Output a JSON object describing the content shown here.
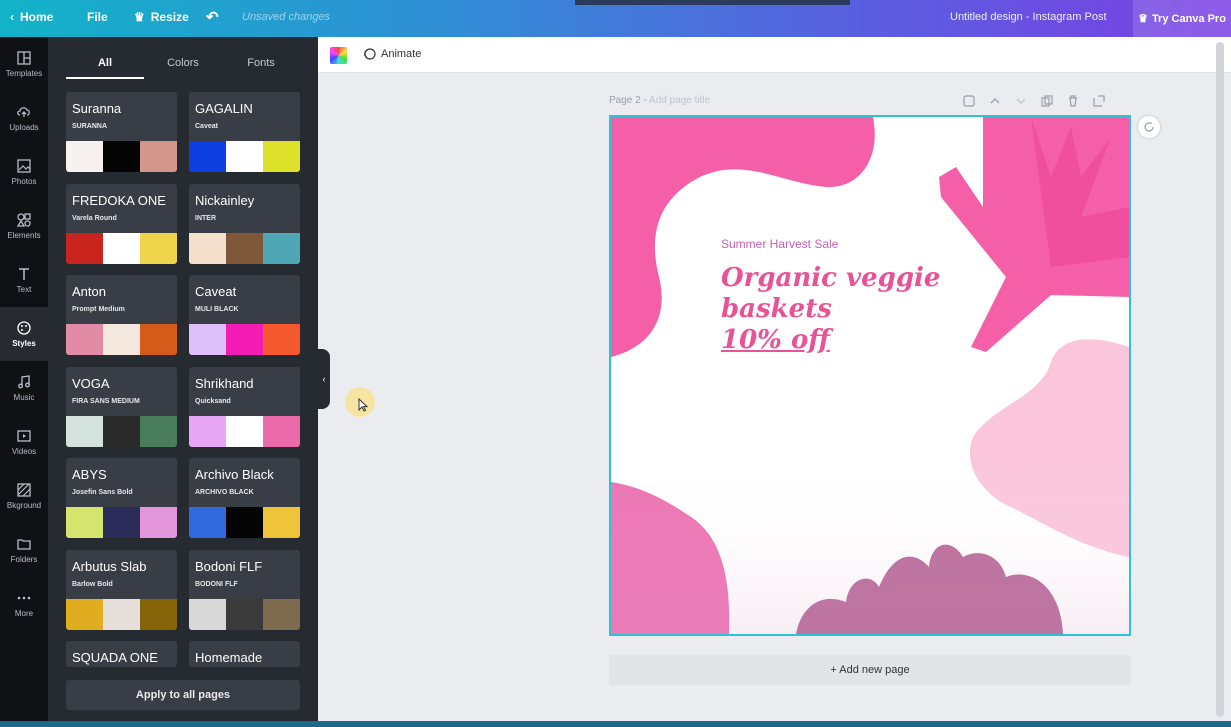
{
  "topbar": {
    "home": "Home",
    "file": "File",
    "resize": "Resize",
    "unsaved": "Unsaved changes",
    "design_title": "Untitled design - Instagram Post",
    "try_pro": "Try Canva Pro"
  },
  "rail": [
    {
      "label": "Templates",
      "icon": "templates-icon"
    },
    {
      "label": "Uploads",
      "icon": "upload-icon"
    },
    {
      "label": "Photos",
      "icon": "photos-icon"
    },
    {
      "label": "Elements",
      "icon": "elements-icon"
    },
    {
      "label": "Text",
      "icon": "text-icon"
    },
    {
      "label": "Styles",
      "icon": "palette-icon",
      "active": true
    },
    {
      "label": "Music",
      "icon": "music-icon"
    },
    {
      "label": "Videos",
      "icon": "videos-icon"
    },
    {
      "label": "Bkground",
      "icon": "background-icon"
    },
    {
      "label": "Folders",
      "icon": "folder-icon"
    },
    {
      "label": "More",
      "icon": "more-icon"
    }
  ],
  "panel": {
    "tabs": [
      "All",
      "Colors",
      "Fonts"
    ],
    "active_tab": "All",
    "cards": [
      {
        "heading": "Suranna",
        "sub": "SURANNA",
        "colors": [
          "#f7f1f0",
          "#050505",
          "#d4958a"
        ]
      },
      {
        "heading": "GAGALIN",
        "sub": "Caveat",
        "colors": [
          "#0d3fe0",
          "#ffffff",
          "#dde12a"
        ]
      },
      {
        "heading": "FREDOKA ONE",
        "sub": "Varela Round",
        "colors": [
          "#c8241d",
          "#ffffff",
          "#efd54c"
        ]
      },
      {
        "heading": "Nickainley",
        "sub": "INTER",
        "colors": [
          "#f4dfcc",
          "#7e5838",
          "#4fa6b4"
        ]
      },
      {
        "heading": "Anton",
        "sub": "Prompt Medium",
        "colors": [
          "#e18ba7",
          "#f4e7de",
          "#d55b1b"
        ]
      },
      {
        "heading": "Caveat",
        "sub": "MULI BLACK",
        "colors": [
          "#dcc0f7",
          "#f31db5",
          "#f4582c"
        ]
      },
      {
        "heading": "VOGA",
        "sub": "FIRA SANS MEDIUM",
        "colors": [
          "#d3e2dd",
          "#2a2a2a",
          "#4a7d5c"
        ]
      },
      {
        "heading": "Shrikhand",
        "sub": "Quicksand",
        "colors": [
          "#e6a6f4",
          "#ffffff",
          "#ea6aaa"
        ]
      },
      {
        "heading": "ABYS",
        "sub": "Josefin Sans Bold",
        "colors": [
          "#d4e46c",
          "#2b2c5a",
          "#e396d9"
        ]
      },
      {
        "heading": "Archivo Black",
        "sub": "ARCHIVO BLACK",
        "colors": [
          "#2f69dd",
          "#050505",
          "#f0c43a"
        ]
      },
      {
        "heading": "Arbutus Slab",
        "sub": "Barlow Bold",
        "colors": [
          "#e0ad20",
          "#e6dfd9",
          "#86650a"
        ]
      },
      {
        "heading": "Bodoni FLF",
        "sub": "BODONI FLF",
        "colors": [
          "#d9d8d8",
          "#3a3a3a",
          "#7e6a4c"
        ]
      },
      {
        "heading": "SQUADA ONE",
        "sub": "",
        "colors": []
      },
      {
        "heading": "Homemade",
        "sub": "",
        "colors": []
      }
    ],
    "apply_label": "Apply to all pages"
  },
  "toolbar": {
    "animate": "Animate"
  },
  "page": {
    "label": "Page 2",
    "title_placeholder": "Add page title",
    "add_page": "+ Add new page"
  },
  "design": {
    "subtitle": "Summer Harvest Sale",
    "headline_line1": "Organic veggie",
    "headline_line2": "baskets",
    "headline_line3": "10% off",
    "colors": {
      "pink": "#f55fa8",
      "light_pink": "#fbc6dc",
      "mauve": "#b86a98",
      "text_pink": "#e95296"
    }
  }
}
